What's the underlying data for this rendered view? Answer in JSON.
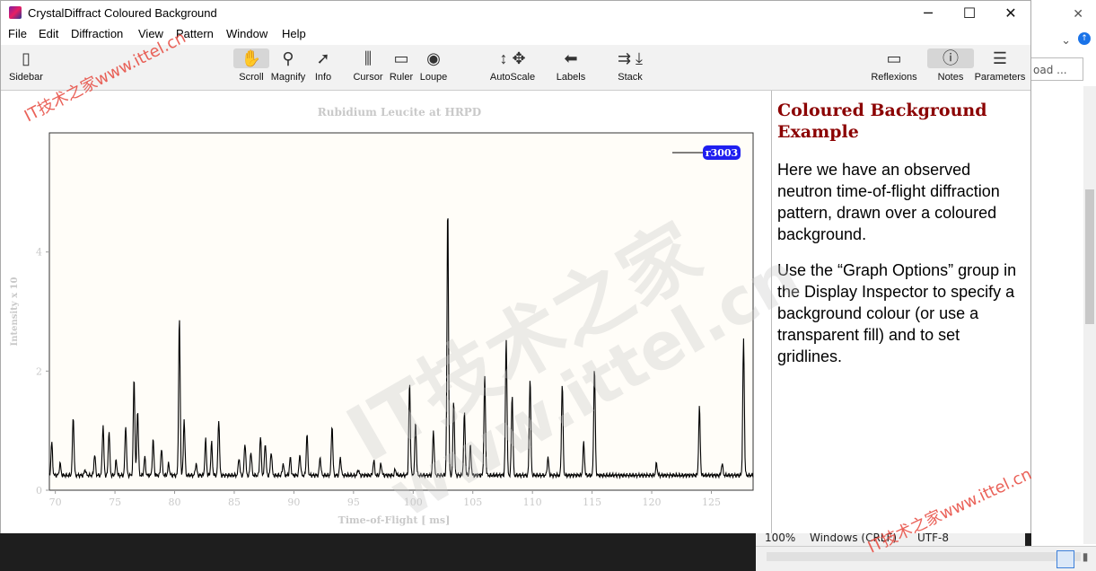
{
  "window": {
    "title": "CrystalDiffract Coloured Background",
    "controls": [
      "minimize",
      "maximize",
      "close"
    ]
  },
  "menu": [
    "File",
    "Edit",
    "Diffraction",
    "View",
    "Pattern",
    "Window",
    "Help"
  ],
  "toolbar": {
    "sidebar": "Sidebar",
    "scroll": "Scroll",
    "magnify": "Magnify",
    "info": "Info",
    "cursor": "Cursor",
    "ruler": "Ruler",
    "loupe": "Loupe",
    "autoscale": "AutoScale",
    "labels": "Labels",
    "stack": "Stack",
    "reflexions": "Reflexions",
    "notes": "Notes",
    "parameters": "Parameters"
  },
  "chart_data": {
    "type": "line",
    "title": "Rubidium Leucite at HRPD",
    "xlabel": "Time-of-Flight [ ms]",
    "ylabel": "Intensity x 10",
    "xlim": [
      69.5,
      128.5
    ],
    "ylim": [
      0,
      6
    ],
    "x_ticks": [
      "70",
      "75",
      "80",
      "85",
      "90",
      "95",
      "100",
      "105",
      "110",
      "115",
      "120",
      "125"
    ],
    "y_ticks": [
      "0",
      "2",
      "4"
    ],
    "legend": "top-right",
    "background": "#fffdf8",
    "series": [
      {
        "name": "r3003",
        "color": "#000000",
        "baseline": 0.25,
        "peaks": [
          [
            69.7,
            0.8
          ],
          [
            70.4,
            0.45
          ],
          [
            71.5,
            1.25
          ],
          [
            72.5,
            0.35
          ],
          [
            73.3,
            0.6
          ],
          [
            74,
            1.1
          ],
          [
            74.5,
            1.0
          ],
          [
            75.1,
            0.5
          ],
          [
            75.9,
            1.1
          ],
          [
            76.6,
            1.9
          ],
          [
            76.9,
            1.35
          ],
          [
            77.5,
            0.55
          ],
          [
            78.2,
            0.85
          ],
          [
            78.9,
            0.7
          ],
          [
            79.5,
            0.45
          ],
          [
            80.4,
            2.9
          ],
          [
            80.8,
            1.2
          ],
          [
            81.8,
            0.45
          ],
          [
            82.6,
            0.85
          ],
          [
            83.1,
            0.8
          ],
          [
            83.7,
            1.2
          ],
          [
            85.4,
            0.55
          ],
          [
            85.9,
            0.8
          ],
          [
            86.4,
            0.65
          ],
          [
            87.2,
            0.9
          ],
          [
            87.6,
            0.8
          ],
          [
            88.1,
            0.65
          ],
          [
            89.1,
            0.45
          ],
          [
            89.7,
            0.55
          ],
          [
            90.5,
            0.6
          ],
          [
            91.1,
            0.95
          ],
          [
            92.2,
            0.55
          ],
          [
            93.2,
            1.1
          ],
          [
            93.9,
            0.55
          ],
          [
            95.4,
            0.35
          ],
          [
            96.7,
            0.5
          ],
          [
            97.3,
            0.45
          ],
          [
            98.5,
            0.35
          ],
          [
            99.7,
            1.8
          ],
          [
            100.2,
            1.15
          ],
          [
            101.7,
            1.0
          ],
          [
            102.9,
            4.8
          ],
          [
            103.4,
            1.5
          ],
          [
            104.3,
            1.3
          ],
          [
            104.8,
            0.75
          ],
          [
            106.0,
            1.9
          ],
          [
            107.8,
            2.55
          ],
          [
            108.3,
            1.6
          ],
          [
            109.8,
            1.9
          ],
          [
            111.3,
            0.55
          ],
          [
            112.5,
            1.8
          ],
          [
            114.3,
            0.8
          ],
          [
            115.2,
            2.05
          ],
          [
            120.4,
            0.45
          ],
          [
            124.0,
            1.4
          ],
          [
            125.9,
            0.45
          ],
          [
            127.7,
            2.55
          ]
        ]
      }
    ]
  },
  "notes": {
    "heading": "Coloured Background Example",
    "para1": "Here we have an observed neutron time-of-flight diffraction pattern, drawn over a coloured background.",
    "para2": "Use the “Graph Options” group in the Display Inspector to specify a background colour (or use a transparent fill) and to set gridlines."
  },
  "background_app": {
    "field_text": "oad ...",
    "status": [
      "100%",
      "Windows (CRLF)",
      "UTF-8"
    ]
  },
  "watermarks": {
    "big1": "IT技术之家",
    "big2": "www.ittel.cn",
    "small1": "IT技术之家www.ittel.cn",
    "small2": "IT技术之家www.ittel.cn"
  }
}
